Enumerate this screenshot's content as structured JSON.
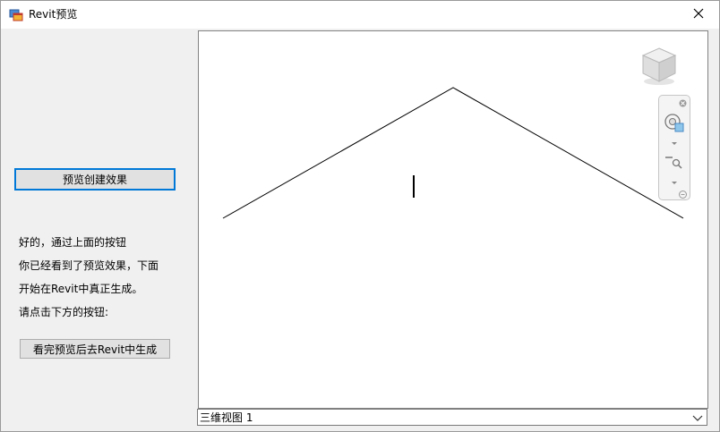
{
  "window": {
    "title": "Revit预览",
    "close_icon": "close-icon",
    "app_icon": "form-icon"
  },
  "left_panel": {
    "preview_button_label": "预览创建效果",
    "message_lines": [
      "好的，通过上面的按钮",
      "你已经看到了预览效果，下面",
      "开始在Revit中真正生成。",
      "请点击下方的按钮:"
    ],
    "generate_button_label": "看完预览后去Revit中生成"
  },
  "viewport": {
    "background": "#ffffff",
    "line_color": "#000000",
    "viewcube_icon": "viewcube-icon",
    "nav_bar_icons": [
      "navbar-close-icon",
      "steering-wheel-icon",
      "zoom-icon",
      "navbar-menu-icon"
    ]
  },
  "view_selector": {
    "selected": "三维视图 1",
    "arrow_icon": "chevron-down-icon"
  }
}
